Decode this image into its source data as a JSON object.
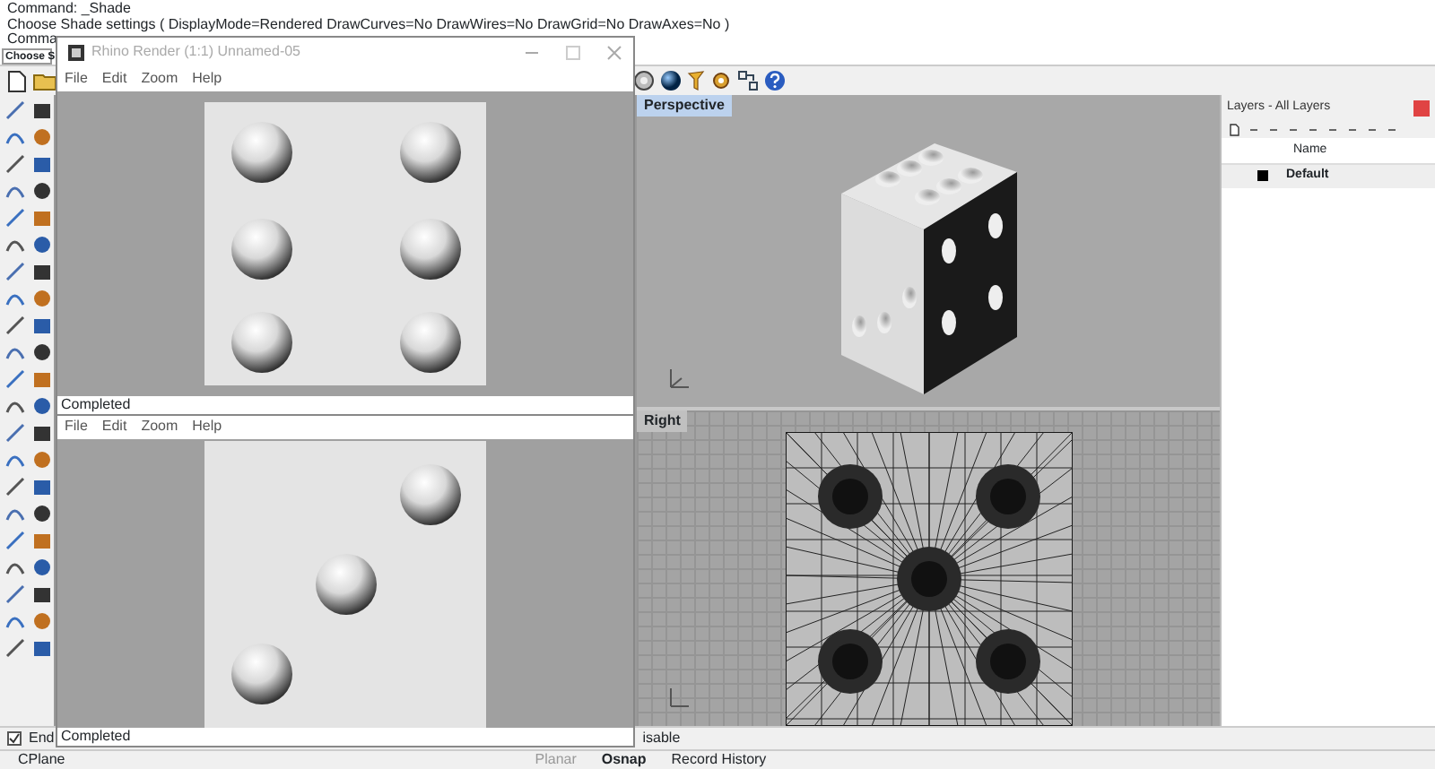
{
  "command_history": [
    "Command: _Shade",
    "Choose Shade settings ( DisplayMode=Rendered  DrawCurves=No  DrawWires=No  DrawGrid=No  DrawAxes=No )",
    "Comma"
  ],
  "command_prompt": "Choose S",
  "viewports": [
    {
      "title": "Perspective",
      "selected": true,
      "kind": "shaded"
    },
    {
      "title": "Right",
      "selected": false,
      "kind": "mesh"
    }
  ],
  "layers_panel": {
    "title": "Layers - All Layers",
    "columns": [
      "Name"
    ],
    "layers": [
      {
        "name": "Default",
        "current": true,
        "color": "#000000"
      }
    ]
  },
  "osnap_bar": {
    "items": [
      {
        "label": "End",
        "checked": true
      }
    ],
    "trailing": "isable"
  },
  "status_bar": [
    "CPlane",
    "Planar",
    "Osnap",
    "Record History"
  ],
  "render_windows": [
    {
      "title": "Rhino Render (1:1) Unnamed-05",
      "menu": [
        "File",
        "Edit",
        "Zoom",
        "Help"
      ],
      "kind": "six",
      "status": "Completed"
    },
    {
      "menu": [
        "File",
        "Edit",
        "Zoom",
        "Help"
      ],
      "kind": "three",
      "status": "Completed"
    }
  ]
}
